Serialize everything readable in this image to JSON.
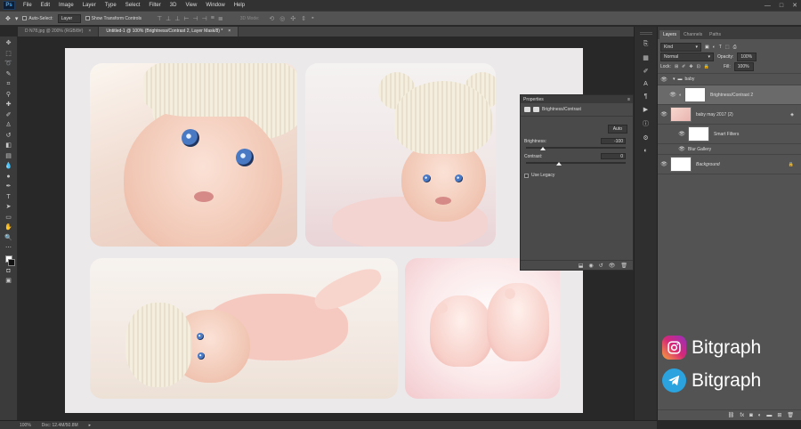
{
  "app": {
    "logo": "Ps"
  },
  "menu": [
    "File",
    "Edit",
    "Image",
    "Layer",
    "Type",
    "Select",
    "Filter",
    "3D",
    "View",
    "Window",
    "Help"
  ],
  "window_controls": [
    "—",
    "□",
    "✕"
  ],
  "options": {
    "auto_select_label": "Auto-Select:",
    "auto_select_value": "Layer",
    "show_transform_label": "Show Transform Controls",
    "mode_3d_label": "3D Mode:"
  },
  "tabs": [
    {
      "label": "D N78.jpg @ 200% (RGB/8#)",
      "close": "×",
      "active": false
    },
    {
      "label": "Untitled-1 @ 100% (Brightness/Contrast 2, Layer Mask/8) *",
      "close": "×",
      "active": true
    }
  ],
  "properties": {
    "header": "Properties",
    "title": "Brightness/Contrast",
    "auto_label": "Auto",
    "brightness_label": "Brightness:",
    "brightness_value": "-100",
    "brightness_level": -100,
    "contrast_label": "Contrast:",
    "contrast_value": "0",
    "contrast_level": 0,
    "use_legacy_label": "Use Legacy",
    "use_legacy_checked": false
  },
  "layers_panel": {
    "tabs": [
      "Layers",
      "Channels",
      "Paths"
    ],
    "kind_label": "Kind",
    "blend_mode": "Normal",
    "opacity_label": "Opacity:",
    "opacity_value": "100%",
    "lock_label": "Lock:",
    "fill_label": "Fill:",
    "fill_value": "100%",
    "layers": [
      {
        "name": "baby",
        "type": "group"
      },
      {
        "name": "Brightness/Contrast 2",
        "type": "adjustment",
        "selected": true
      },
      {
        "name": "baby may 2017 (2)",
        "type": "smart"
      },
      {
        "name": "Smart Filters",
        "type": "filtermask"
      },
      {
        "name": "Blur Gallery",
        "type": "filter"
      },
      {
        "name": "Background",
        "type": "background"
      }
    ]
  },
  "status": {
    "zoom": "100%",
    "doc": "Doc: 12.4M/50.8M"
  },
  "brand": [
    {
      "network": "instagram",
      "label": "Bitgraph",
      "color": "#d62976"
    },
    {
      "network": "telegram",
      "label": "Bitgraph",
      "color": "#2aa3df"
    }
  ]
}
